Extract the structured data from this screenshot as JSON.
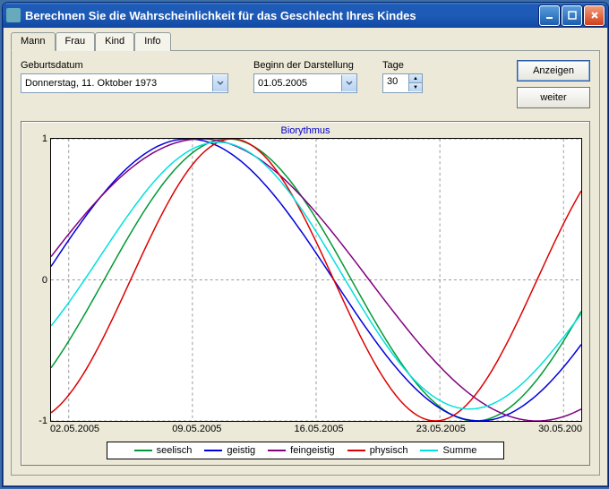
{
  "window": {
    "title": "Berechnen Sie die Wahrscheinlichkeit für das Geschlecht Ihres Kindes"
  },
  "tabs": [
    "Mann",
    "Frau",
    "Kind",
    "Info"
  ],
  "active_tab": 0,
  "fields": {
    "birth_label": "Geburtsdatum",
    "birth_value": "Donnerstag, 11.   Oktober   1973",
    "start_label": "Beginn der Darstellung",
    "start_value": "01.05.2005",
    "days_label": "Tage",
    "days_value": "30"
  },
  "buttons": {
    "show": "Anzeigen",
    "next": "weiter"
  },
  "chart_data": {
    "type": "line",
    "title": "Biorythmus",
    "ylim": [
      -1,
      1
    ],
    "yticks": [
      -1,
      0,
      1
    ],
    "x_dates": [
      "02.05.2005",
      "09.05.2005",
      "16.05.2005",
      "23.05.2005",
      "30.05.200"
    ],
    "x_range_days": [
      0,
      30
    ],
    "series": [
      {
        "name": "seelisch",
        "color": "#009933",
        "period": 28,
        "phase_offset_days": 3.0,
        "type": "sin"
      },
      {
        "name": "geistig",
        "color": "#0000dd",
        "period": 33,
        "phase_offset_days": -0.5,
        "type": "sin"
      },
      {
        "name": "feingeistig",
        "color": "#800080",
        "period": 38,
        "phase_offset_days": -1.0,
        "type": "sin"
      },
      {
        "name": "physisch",
        "color": "#dd0000",
        "period": 23,
        "phase_offset_days": 4.5,
        "type": "sin"
      },
      {
        "name": "Summe",
        "color": "#00e0e0",
        "sum_of": [
          "seelisch",
          "geistig",
          "feingeistig",
          "physisch"
        ],
        "scale": 0.25
      }
    ],
    "legend": [
      "seelisch",
      "geistig",
      "feingeistig",
      "physisch",
      "Summe"
    ]
  }
}
